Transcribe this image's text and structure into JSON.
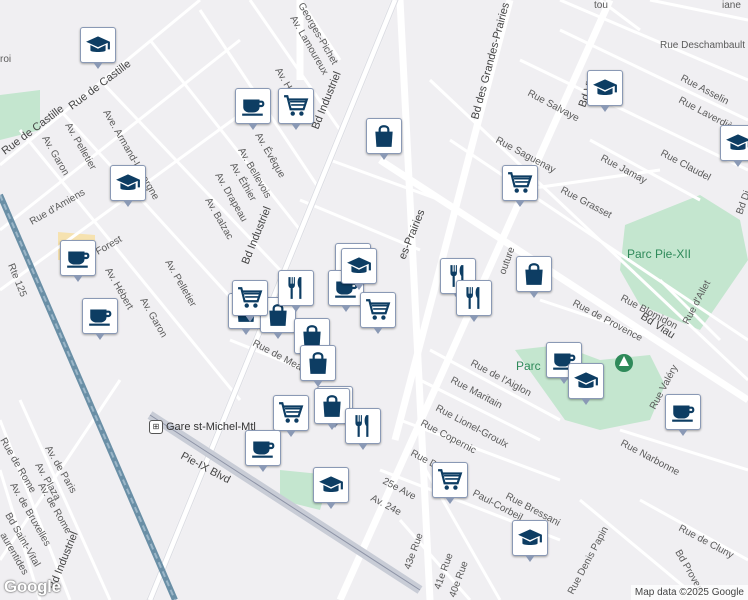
{
  "attribution": "Map data ©2025 Google",
  "logo": "Google",
  "station_label": "Gare st-Michel-Mtl",
  "park_labels": [
    "Parc Pie-XII",
    "Parc"
  ],
  "street_labels": {
    "rue_de_castille_1": "Rue de Castille",
    "rue_de_castille_2": "Rue de Castille",
    "rue_damiens": "Rue d'Amiens",
    "rte125": "Rte 125",
    "pie_ix": "Pie-IX Blvd",
    "bd_industriel_1": "Bd Industriel",
    "bd_industriel_2": "Bd Industriel",
    "bd_industriel_3": "Bd Industriel",
    "bd_grandes_prairies": "Bd des Grandes-Prairies",
    "des_prairies": "es-Prairies",
    "bd_viau_1": "Bd Viau",
    "bd_viau_2": "Bd Viau",
    "rue_saguenay": "Rue Saguenay",
    "rue_salvaye": "Rue Salvaye",
    "rue_jamay": "Rue Jamay",
    "rue_grasset": "Rue Grasset",
    "rue_claudel": "Rue Claudel",
    "rue_asselin": "Rue Asselin",
    "rue_laverdiere": "Rue Laverdière",
    "rue_deschambault": "Rue Deschambault",
    "rue_blomidon": "Rue Blomidon",
    "rue_dallet": "Rue d'Allet",
    "rue_de_provence": "Rue de Provence",
    "rue_de_laiglon": "Rue de l'Aiglon",
    "rue_maritain": "Rue Maritain",
    "rue_lionel_groulx": "Rue Lionel-Groulx",
    "rue_copernic": "Rue Copernic",
    "rue_descartes": "Rue Descart",
    "rue_paul_corbeil": "Paul-Corbeil",
    "rue_bressani": "Rue Bressani",
    "rue_narbonne": "Rue Narbonne",
    "rue_denis_papin": "Rue Denis Papin",
    "rue_de_cluny": "Rue de Cluny",
    "bd_provencher": "Bd Proven",
    "rue_de_mea": "Rue de Mea",
    "av_25e": "25e Ave",
    "av_24e": "Av. 24e",
    "rue_43e": "43e Rue",
    "rue_41e": "41e Rue",
    "rue_40e": "40e Rue",
    "rue_24": "Av. 24e",
    "couture": "outure",
    "rue_valery": "Rue Valéry",
    "av_georges_pichet": "Georges-Pichet",
    "av_lamoureux": "Av. Lamoureux",
    "av_armand_lavergne": "Ave. Armand-Lavergne",
    "av_garon_1": "Av. Garon",
    "av_garon_2": "Av. Garon",
    "av_pelletier_1": "Av. Pelletier",
    "av_pelletier_2": "Av. Pelletier",
    "av_hebert": "Av. Hébert",
    "av_forest": "Forest",
    "av_belleville": "Av. Bellevois",
    "av_eveque": "Av. Évêque",
    "av_ethier": "Av. Éthier",
    "av_drapeau": "Av. Drapeau",
    "av_balzac": "Av. Balzac",
    "av_h": "Av. H",
    "av_de_rome_1": "Rue de Rome",
    "av_de_paris": "Av. de Paris",
    "av_plaza": "Av. Plaza",
    "av_de_rome_2": "Av. de Rome",
    "av_de_bruxelles": "Av. de Bruxelles",
    "bd_saint_vital": "Bd Saint-Vital",
    "laurentides": "aurentides",
    "bd_trou": "tou",
    "iane": "iane",
    "bd_di": "Bd Di",
    "rue_roi": "roi"
  },
  "pins": [
    {
      "name": "school-pin-1",
      "icon": "school"
    },
    {
      "name": "cafe-pin-1",
      "icon": "cafe"
    },
    {
      "name": "grocery-pin-1",
      "icon": "grocery"
    },
    {
      "name": "shopping-pin-1",
      "icon": "shopping"
    },
    {
      "name": "school-pin-2",
      "icon": "school"
    },
    {
      "name": "school-pin-3",
      "icon": "school"
    },
    {
      "name": "school-pin-4",
      "icon": "school"
    },
    {
      "name": "grocery-pin-2",
      "icon": "grocery"
    },
    {
      "name": "cafe-pin-2",
      "icon": "cafe"
    },
    {
      "name": "cafe-pin-3",
      "icon": "cafe"
    },
    {
      "name": "shopping-pin-2",
      "icon": "shopping"
    },
    {
      "name": "shopping-pin-3",
      "icon": "shopping"
    },
    {
      "name": "restaurant-pin-1",
      "icon": "restaurant"
    },
    {
      "name": "grocery-pin-3",
      "icon": "grocery"
    },
    {
      "name": "restaurant-pin-2",
      "icon": "restaurant"
    },
    {
      "name": "cafe-pin-4",
      "icon": "cafe"
    },
    {
      "name": "grocery-pin-4",
      "icon": "grocery"
    },
    {
      "name": "shopping-pin-4",
      "icon": "shopping"
    },
    {
      "name": "shopping-pin-5",
      "icon": "shopping"
    },
    {
      "name": "shopping-pin-6",
      "icon": "shopping"
    },
    {
      "name": "grocery-pin-5",
      "icon": "grocery"
    },
    {
      "name": "shopping-pin-7",
      "icon": "shopping"
    },
    {
      "name": "restaurant-pin-3",
      "icon": "restaurant"
    },
    {
      "name": "cafe-pin-5",
      "icon": "cafe"
    },
    {
      "name": "school-pin-5",
      "icon": "school"
    },
    {
      "name": "restaurant-pin-4",
      "icon": "restaurant"
    },
    {
      "name": "restaurant-pin-5",
      "icon": "restaurant"
    },
    {
      "name": "shopping-pin-8",
      "icon": "shopping"
    },
    {
      "name": "cafe-pin-6",
      "icon": "cafe"
    },
    {
      "name": "school-pin-6",
      "icon": "school"
    },
    {
      "name": "grocery-pin-6",
      "icon": "grocery"
    },
    {
      "name": "school-pin-7",
      "icon": "school"
    },
    {
      "name": "cafe-pin-7",
      "icon": "cafe"
    },
    {
      "name": "school-pin-8",
      "icon": "school"
    }
  ],
  "colors": {
    "background": "#f0eff2",
    "road": "#ffffff",
    "highway": "#c8ccd6",
    "rail": "#6a8fa6",
    "park": "#c4e6cf",
    "pin_icon": "#0d3d63"
  }
}
